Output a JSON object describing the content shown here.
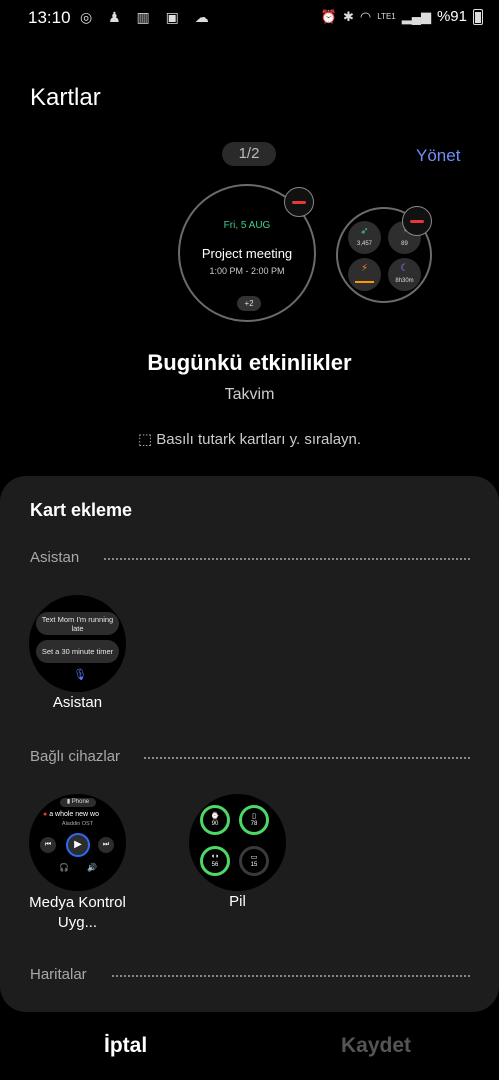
{
  "status": {
    "time": "13:10",
    "battery": "%91",
    "network": "LTE1"
  },
  "page": {
    "title": "Kartlar",
    "pager": "1/2",
    "manage": "Yönet"
  },
  "preview": {
    "date": "Fri, 5 AUG",
    "event_title": "Project meeting",
    "event_time": "1:00 PM - 2:00 PM",
    "more": "+2",
    "mini_values": [
      "3,457",
      "89",
      "",
      "8h30m"
    ]
  },
  "selected_card": {
    "name": "Bugünkü etkinlikler",
    "source": "Takvim"
  },
  "hint": "Basılı tutark kartları y. sıralayn.",
  "add_sheet": {
    "title": "Kart ekleme",
    "sections": [
      {
        "label": "Asistan"
      },
      {
        "label": "Bağlı cihazlar"
      },
      {
        "label": "Haritalar"
      }
    ],
    "assistant_tile": {
      "pill1": "Text Mom I'm running late",
      "pill2": "Set a 30 minute timer",
      "label": "Asistan"
    },
    "media_tile": {
      "device": "Phone",
      "song": "a whole new wo",
      "artist": "Aladdin OST",
      "label": "Medya Kontrol Uyg..."
    },
    "battery_tile": {
      "values": [
        "90",
        "78",
        "56",
        "15"
      ],
      "label": "Pil"
    }
  },
  "actions": {
    "cancel": "İptal",
    "save": "Kaydet"
  },
  "colors": {
    "accent": "#6f8ff8",
    "remove": "#e53935",
    "calendar_date": "#3ecf8e",
    "battery_ring": "#4cd964"
  }
}
